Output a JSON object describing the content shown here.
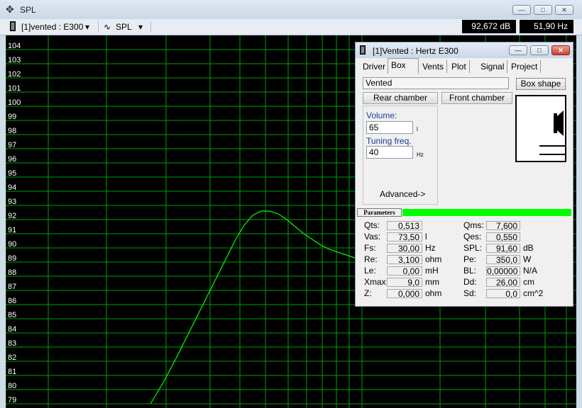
{
  "window": {
    "title": "SPL",
    "controls": {
      "minimize": "—",
      "maximize": "□",
      "close": "✕"
    }
  },
  "toolbar": {
    "project_selector": "[1]vented : E300",
    "view_selector": "SPL",
    "readout_db": "92,672 dB",
    "readout_hz": "51,90 Hz"
  },
  "chart_data": {
    "type": "line",
    "title": "",
    "xlabel": "",
    "ylabel": "",
    "ylim": [
      79,
      105
    ],
    "y_ticks": [
      104,
      103,
      102,
      101,
      100,
      99,
      98,
      97,
      96,
      95,
      94,
      93,
      92,
      91,
      90,
      89,
      88,
      87,
      86,
      85,
      84,
      83,
      82,
      81,
      80,
      79
    ],
    "grid": true,
    "grid_color": "#00a000",
    "line_color": "#00ff00",
    "series": [
      {
        "x": [
          0.0,
          0.03,
          0.06,
          0.09,
          0.12,
          0.15,
          0.18,
          0.2,
          0.22,
          0.24,
          0.26,
          0.28,
          0.3,
          0.32,
          0.34,
          0.36,
          0.38,
          0.4,
          0.42,
          0.45,
          0.48,
          0.52,
          0.56,
          0.6,
          0.62
        ],
        "y": [
          79.0,
          80.5,
          82.2,
          84.0,
          85.8,
          87.6,
          89.4,
          90.6,
          91.6,
          92.3,
          92.6,
          92.6,
          92.4,
          92.0,
          91.5,
          91.0,
          90.6,
          90.2,
          89.9,
          89.6,
          89.3,
          89.1,
          88.9,
          88.8,
          88.8
        ]
      }
    ]
  },
  "dialog": {
    "title": "[1]Vented : Hertz E300",
    "tabs": [
      "Driver",
      "Box",
      "Vents",
      "Plot",
      "Signal",
      "Project"
    ],
    "active_tab": "Box",
    "box_type": "Vented",
    "box_shape_button": "Box shape",
    "rear_chamber_button": "Rear chamber",
    "front_chamber_button": "Front chamber",
    "volume_label": "Volume:",
    "volume_value": "65",
    "volume_unit": "l",
    "tuning_label": "Tuning freq.",
    "tuning_value": "40",
    "tuning_unit": "Hz",
    "advanced_button": "Advanced->",
    "parameters_tab": "Parameters",
    "left_params": [
      {
        "name": "Qts:",
        "value": "0,513",
        "unit": ""
      },
      {
        "name": "Vas:",
        "value": "73,50",
        "unit": "l"
      },
      {
        "name": "Fs:",
        "value": "30,00",
        "unit": "Hz"
      },
      {
        "name": "Re:",
        "value": "3,100",
        "unit": "ohm"
      },
      {
        "name": "Le:",
        "value": "0,00",
        "unit": "mH"
      },
      {
        "name": "Xmax:",
        "value": "9,0",
        "unit": "mm"
      },
      {
        "name": "Z:",
        "value": "0,000",
        "unit": "ohm"
      }
    ],
    "right_params": [
      {
        "name": "Qms:",
        "value": "7,600",
        "unit": ""
      },
      {
        "name": "Qes:",
        "value": "0,550",
        "unit": ""
      },
      {
        "name": "SPL:",
        "value": "91,60",
        "unit": "dB"
      },
      {
        "name": "Pe:",
        "value": "350,0",
        "unit": "W"
      },
      {
        "name": "BL:",
        "value": "0,00000",
        "unit": "N/A"
      },
      {
        "name": "Dd:",
        "value": "26,00",
        "unit": "cm"
      },
      {
        "name": "Sd:",
        "value": "0,0",
        "unit": "cm^2"
      }
    ]
  }
}
